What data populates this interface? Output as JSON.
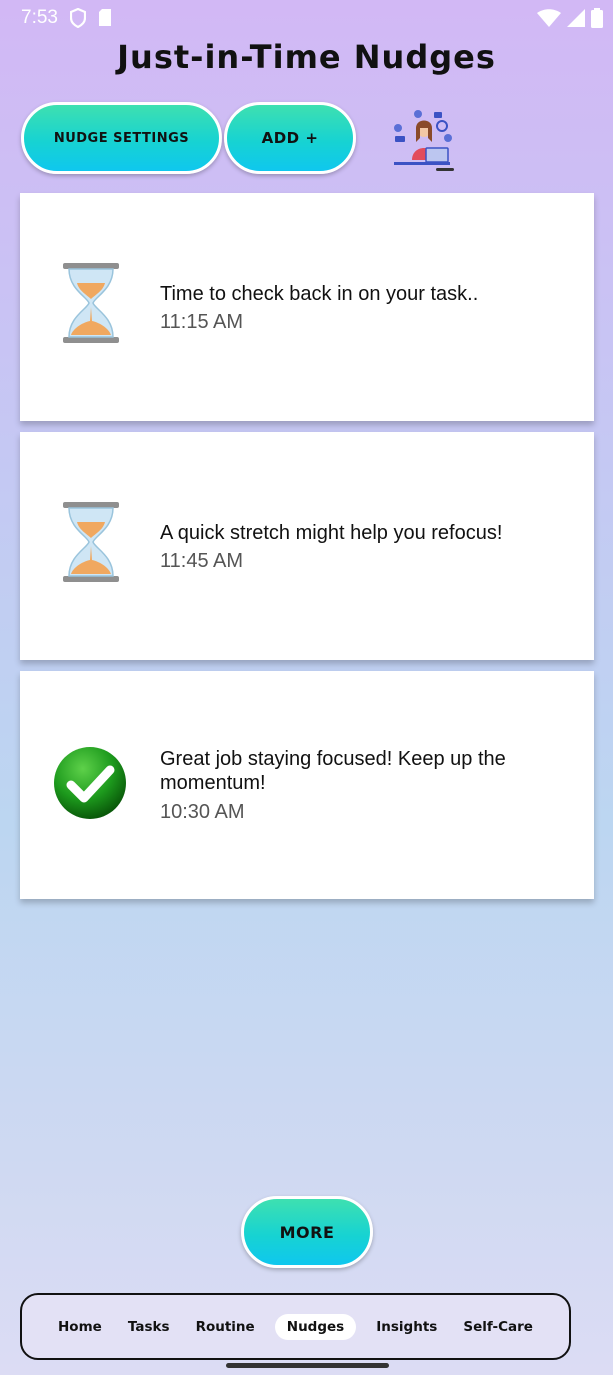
{
  "status_bar": {
    "time": "7:53",
    "left_icons": [
      "shield-icon",
      "sd-card-icon"
    ],
    "right_icons": [
      "wifi-icon",
      "signal-icon",
      "battery-icon"
    ]
  },
  "header": {
    "title": "Just-in-Time Nudges"
  },
  "toolbar": {
    "settings_label": "NUDGE SETTINGS",
    "add_label": "ADD +",
    "illustration": "person-at-laptop-illustration"
  },
  "nudges": [
    {
      "icon": "hourglass-icon",
      "message": "Time to check back in on your task..",
      "time": "11:15 AM"
    },
    {
      "icon": "hourglass-icon",
      "message": "A quick stretch might help you refocus!",
      "time": "11:45 AM"
    },
    {
      "icon": "checkmark-icon",
      "message": "Great job staying focused! Keep up the momentum!",
      "time": "10:30 AM"
    }
  ],
  "more_label": "MORE",
  "nav": {
    "items": [
      {
        "label": "Home"
      },
      {
        "label": "Tasks"
      },
      {
        "label": "Routine"
      },
      {
        "label": "Nudges",
        "active": true
      },
      {
        "label": "Insights"
      },
      {
        "label": "Self-Care"
      }
    ]
  },
  "colors": {
    "button_gradient_start": "#3ee0b0",
    "button_gradient_end": "#0fc7ee",
    "background_top": "#d2b8f5",
    "background_bottom": "#dcdcf4"
  }
}
